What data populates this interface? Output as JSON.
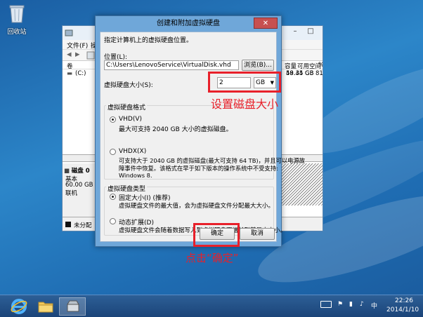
{
  "desktop": {
    "recycle_bin_label": "回收站"
  },
  "back_window": {
    "menu": [
      "文件(F)",
      "操"
    ],
    "columns": {
      "volume": "卷",
      "capacity": "容量",
      "free": "可用空间",
      "percent": "%"
    },
    "volume_row": {
      "name": "(C:)",
      "capacity": "59.45 GB",
      "free": "48.34 GB",
      "percent": "81"
    },
    "disk": {
      "name": "磁盘 0",
      "type": "基本",
      "size": "60.00 GB",
      "status": "联机"
    },
    "legend_unallocated": "未分配"
  },
  "dialog": {
    "title": "创建和附加虚拟硬盘",
    "close_glyph": "✕",
    "instruction": "指定计算机上的虚拟硬盘位置。",
    "location_label": "位置(L):",
    "location_value": "C:\\Users\\LenovoService\\VirtualDisk.vhd",
    "browse_label": "浏览(B)...",
    "size_label": "虚拟硬盘大小(S):",
    "size_value": "2",
    "size_unit": "GB",
    "format_group_label": "虚拟硬盘格式",
    "vhd_label": "VHD(V)",
    "vhd_desc": "最大可支持 2040 GB 大小的虚拟磁盘。",
    "vhdx_label": "VHDX(X)",
    "vhdx_desc_1": "可支持大于 2040 GB 的虚拟磁盘(最大可支持 64 TB)，并且可以电源故",
    "vhdx_desc_2": "障事件中恢复。该格式在早于如下版本的操作系统中不受支持:",
    "vhdx_desc_3": "Windows 8.",
    "type_group_label": "虚拟硬盘类型",
    "fixed_label": "固定大小(I) (推荐)",
    "fixed_desc": "虚拟硬盘文件的最大值，会为虚拟硬盘文件分配最大大小。",
    "dynamic_label": "动态扩展(D)",
    "dynamic_desc": "虚拟硬盘文件会随着数据写入到虚拟硬盘而增长到其最大大小。",
    "ok_label": "确定",
    "cancel_label": "取消",
    "selected_format": "VHD",
    "selected_type": "fixed"
  },
  "annotations": {
    "size_note": "设置磁盘大小",
    "ok_note": "点击“确定”",
    "color": "#e8202a"
  },
  "taskbar": {
    "time": "22:26",
    "date": "2014/1/10"
  }
}
